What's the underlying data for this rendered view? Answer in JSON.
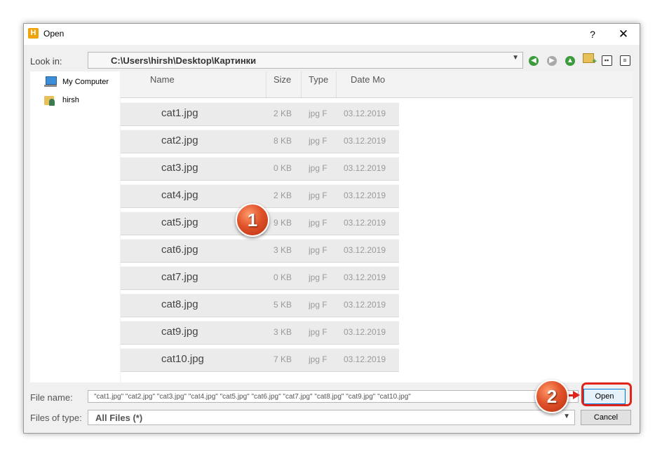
{
  "window": {
    "title": "Open",
    "app_icon_letter": "H",
    "help_label": "?",
    "close_label": "✕"
  },
  "toolbar": {
    "look_in_label": "Look in:",
    "path": "C:\\Users\\hirsh\\Desktop\\Картинки",
    "icons": [
      "back-icon",
      "forward-icon",
      "up-folder-icon",
      "new-folder-icon",
      "list-view-icon",
      "details-view-icon"
    ]
  },
  "sidebar": {
    "items": [
      {
        "label": "My Computer",
        "icon": "computer-icon"
      },
      {
        "label": "hirsh",
        "icon": "user-folder-icon"
      }
    ]
  },
  "file_list": {
    "columns": [
      "Name",
      "Size",
      "Type",
      "Date Mo"
    ],
    "rows": [
      {
        "name": "cat1.jpg",
        "size": "2 KB",
        "type": "jpg F",
        "date": "03.12.2019"
      },
      {
        "name": "cat2.jpg",
        "size": "8 KB",
        "type": "jpg F",
        "date": "03.12.2019"
      },
      {
        "name": "cat3.jpg",
        "size": "0 KB",
        "type": "jpg F",
        "date": "03.12.2019"
      },
      {
        "name": "cat4.jpg",
        "size": "2 KB",
        "type": "jpg F",
        "date": "03.12.2019"
      },
      {
        "name": "cat5.jpg",
        "size": "9 KB",
        "type": "jpg F",
        "date": "03.12.2019"
      },
      {
        "name": "cat6.jpg",
        "size": "3 KB",
        "type": "jpg F",
        "date": "03.12.2019"
      },
      {
        "name": "cat7.jpg",
        "size": "0 KB",
        "type": "jpg F",
        "date": "03.12.2019"
      },
      {
        "name": "cat8.jpg",
        "size": "5 KB",
        "type": "jpg F",
        "date": "03.12.2019"
      },
      {
        "name": "cat9.jpg",
        "size": "3 KB",
        "type": "jpg F",
        "date": "03.12.2019"
      },
      {
        "name": "cat10.jpg",
        "size": "7 KB",
        "type": "jpg F",
        "date": "03.12.2019"
      }
    ]
  },
  "footer": {
    "file_name_label": "File name:",
    "file_name_value": "\"cat1.jpg\" \"cat2.jpg\" \"cat3.jpg\" \"cat4.jpg\" \"cat5.jpg\" \"cat6.jpg\" \"cat7.jpg\" \"cat8.jpg\" \"cat9.jpg\" \"cat10.jpg\"",
    "file_type_label": "Files of type:",
    "file_type_value": "All Files (*)",
    "open_label": "Open",
    "cancel_label": "Cancel"
  },
  "annotations": {
    "step1": "1",
    "step2": "2",
    "color": "#e0241c"
  }
}
